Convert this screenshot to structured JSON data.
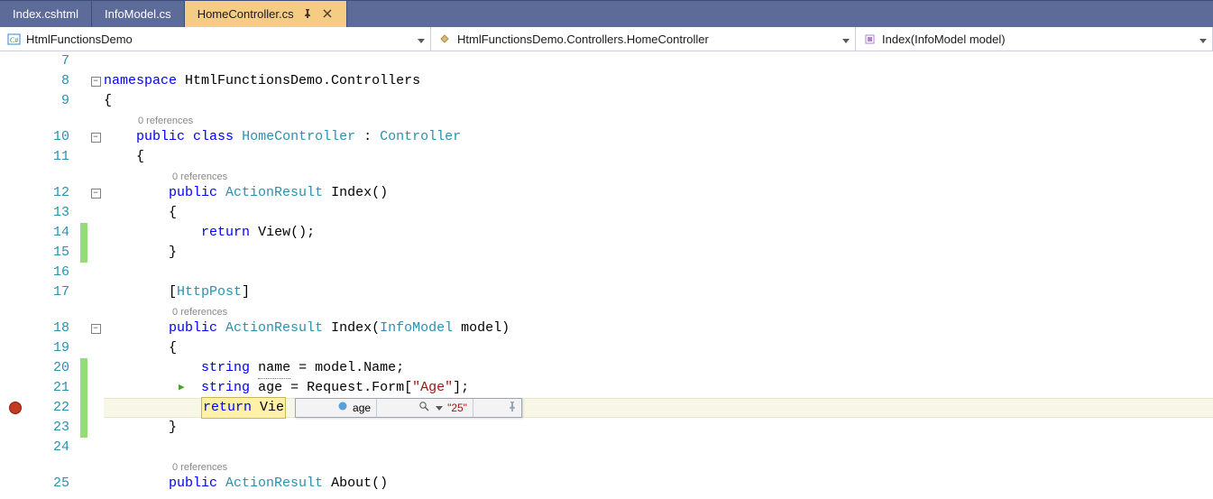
{
  "tabs": [
    {
      "label": "Index.cshtml",
      "active": false
    },
    {
      "label": "InfoModel.cs",
      "active": false
    },
    {
      "label": "HomeController.cs",
      "active": true
    }
  ],
  "context": {
    "project": "HtmlFunctionsDemo",
    "class": "HtmlFunctionsDemo.Controllers.HomeController",
    "member": "Index(InfoModel model)"
  },
  "lines": {
    "l7": {
      "num": "7",
      "text": ""
    },
    "l8": {
      "num": "8",
      "kw1": "namespace",
      "ns": "HtmlFunctionsDemo.Controllers"
    },
    "l9": {
      "num": "9",
      "brace": "{"
    },
    "ref_a": "0 references",
    "l10": {
      "num": "10",
      "kw1": "public",
      "kw2": "class",
      "name": "HomeController",
      "sep": " : ",
      "base": "Controller"
    },
    "l11": {
      "num": "11",
      "brace": "{"
    },
    "ref_b": "0 references",
    "l12": {
      "num": "12",
      "kw1": "public",
      "type": "ActionResult",
      "sig": "Index()"
    },
    "l13": {
      "num": "13",
      "brace": "{"
    },
    "l14": {
      "num": "14",
      "kw1": "return",
      "call": "View();"
    },
    "l15": {
      "num": "15",
      "brace": "}"
    },
    "l16": {
      "num": "16"
    },
    "l17": {
      "num": "17",
      "open": "[",
      "attr": "HttpPost",
      "close": "]"
    },
    "ref_c": "0 references",
    "l18": {
      "num": "18",
      "kw1": "public",
      "type": "ActionResult",
      "sig1": "Index(",
      "ptype": "InfoModel",
      "sig2": " model)"
    },
    "l19": {
      "num": "19",
      "brace": "{"
    },
    "l20": {
      "num": "20",
      "kw1": "string",
      "var": "name",
      "rest": " = model.Name;"
    },
    "l21": {
      "num": "21",
      "kw1": "string",
      "var": "age",
      "rest1": " = Request.Form[",
      "str": "\"Age\"",
      "rest2": "];"
    },
    "l22": {
      "num": "22",
      "hl": "return Vie"
    },
    "l23": {
      "num": "23",
      "brace": "}"
    },
    "l24": {
      "num": "24"
    },
    "ref_d": "0 references",
    "l25": {
      "num": "25",
      "kw1": "public",
      "type": "ActionResult",
      "sig": "About()"
    }
  },
  "datatip": {
    "var": "age",
    "value": "\"25\""
  }
}
